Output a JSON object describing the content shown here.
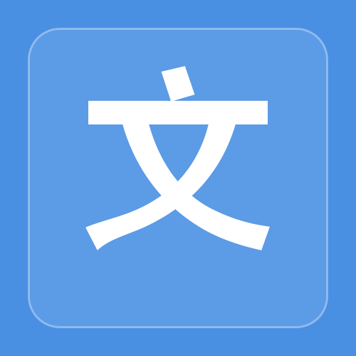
{
  "icon": {
    "glyph": "文",
    "name": "translate-icon",
    "colors": {
      "background": "#4a90e2",
      "tile_fill": "#5c9be6",
      "tile_border": "#8fbaf0",
      "glyph": "#ffffff"
    }
  }
}
